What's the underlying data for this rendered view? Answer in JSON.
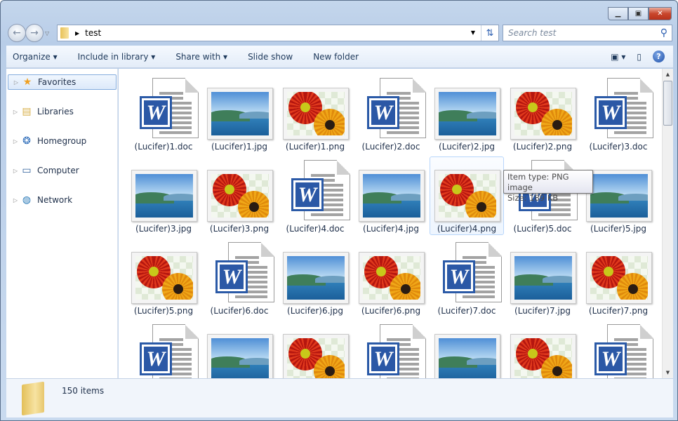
{
  "window": {
    "caption_buttons": [
      "minimize",
      "restore",
      "close"
    ]
  },
  "address": {
    "path": "test",
    "search_placeholder": "Search test"
  },
  "toolbar": {
    "organize": "Organize",
    "include": "Include in library",
    "share": "Share with",
    "slideshow": "Slide show",
    "newfolder": "New folder"
  },
  "sidebar": {
    "items": [
      {
        "label": "Favorites",
        "icon": "star-icon",
        "selected": true
      },
      {
        "label": "Libraries",
        "icon": "libraries-icon"
      },
      {
        "label": "Homegroup",
        "icon": "homegroup-icon"
      },
      {
        "label": "Computer",
        "icon": "computer-icon"
      },
      {
        "label": "Network",
        "icon": "network-icon"
      }
    ]
  },
  "items": [
    {
      "name": "(Lucifer)1.doc",
      "type": "doc"
    },
    {
      "name": "(Lucifer)1.jpg",
      "type": "jpg"
    },
    {
      "name": "(Lucifer)1.png",
      "type": "png"
    },
    {
      "name": "(Lucifer)2.doc",
      "type": "doc"
    },
    {
      "name": "(Lucifer)2.jpg",
      "type": "jpg"
    },
    {
      "name": "(Lucifer)2.png",
      "type": "png"
    },
    {
      "name": "(Lucifer)3.doc",
      "type": "doc"
    },
    {
      "name": "(Lucifer)3.jpg",
      "type": "jpg"
    },
    {
      "name": "(Lucifer)3.png",
      "type": "png"
    },
    {
      "name": "(Lucifer)4.doc",
      "type": "doc"
    },
    {
      "name": "(Lucifer)4.jpg",
      "type": "jpg"
    },
    {
      "name": "(Lucifer)4.png",
      "type": "png",
      "hover": true
    },
    {
      "name": "(Lucifer)5.doc",
      "type": "doc"
    },
    {
      "name": "(Lucifer)5.jpg",
      "type": "jpg"
    },
    {
      "name": "(Lucifer)5.png",
      "type": "png"
    },
    {
      "name": "(Lucifer)6.doc",
      "type": "doc"
    },
    {
      "name": "(Lucifer)6.jpg",
      "type": "jpg"
    },
    {
      "name": "(Lucifer)6.png",
      "type": "png"
    },
    {
      "name": "(Lucifer)7.doc",
      "type": "doc"
    },
    {
      "name": "(Lucifer)7.jpg",
      "type": "jpg"
    },
    {
      "name": "(Lucifer)7.png",
      "type": "png"
    },
    {
      "type": "doc"
    },
    {
      "type": "jpg"
    },
    {
      "type": "png"
    },
    {
      "type": "doc"
    },
    {
      "type": "jpg"
    },
    {
      "type": "png"
    },
    {
      "type": "doc"
    }
  ],
  "tooltip": {
    "line1": "Item type: PNG image",
    "line2": "Size: 189 KB"
  },
  "status": {
    "count": "150 items"
  }
}
